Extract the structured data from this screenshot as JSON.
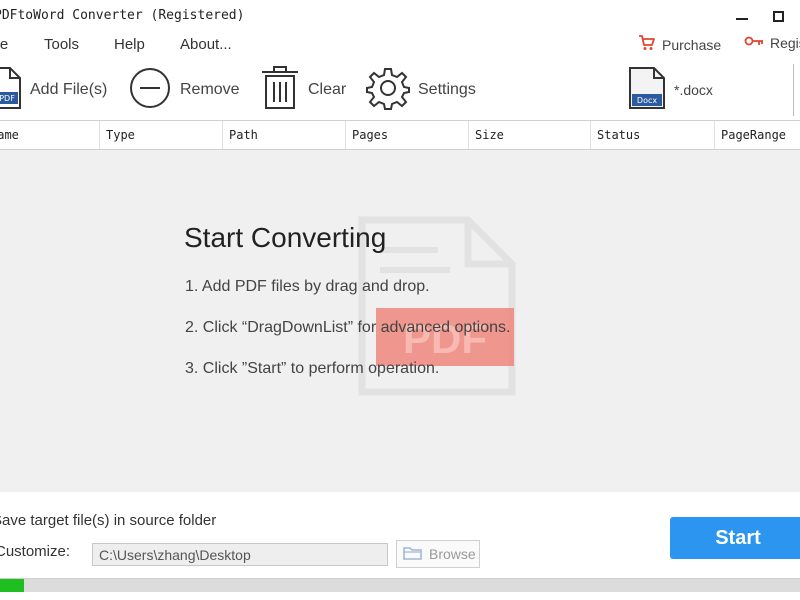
{
  "window": {
    "title": "PDFtoWord Converter (Registered)"
  },
  "menu": {
    "items": [
      {
        "label": "File"
      },
      {
        "label": "Tools"
      },
      {
        "label": "Help"
      },
      {
        "label": "About..."
      }
    ],
    "purchase_label": "Purchase",
    "register_label": "Register"
  },
  "toolbar": {
    "add_files_label": "Add File(s)",
    "remove_label": "Remove",
    "clear_label": "Clear",
    "settings_label": "Settings",
    "output_format_label": "*.docx",
    "docx_badge": "Docx",
    "pdf_badge": "PDF"
  },
  "table": {
    "columns": [
      "Name",
      "Type",
      "Path",
      "Pages",
      "Size",
      "Status",
      "PageRange"
    ]
  },
  "empty_state": {
    "title": "Start Converting",
    "steps": [
      "1. Add PDF files by drag and drop.",
      "2. Click “DragDownList” for advanced options.",
      "3. Click ”Start” to perform operation."
    ],
    "watermark_text": "PDF"
  },
  "output": {
    "save_in_source_label": "Save target file(s) in source folder",
    "customize_label": "Customize:",
    "path_value": "C:\\Users\\zhang\\Desktop",
    "browse_label": "Browse"
  },
  "actions": {
    "start_label": "Start"
  },
  "progress": {
    "value": 0.03
  },
  "colors": {
    "accent": "#2b95f0",
    "progress": "#1fbf1f",
    "purchase_icon": "#e0452f",
    "watermark_badge": "#ef7a6f"
  },
  "icons": {
    "add": "pdf-file-icon",
    "remove": "minus-circle-icon",
    "clear": "trash-icon",
    "settings": "gear-icon",
    "format": "docx-file-icon",
    "purchase": "cart-icon",
    "register": "key-icon",
    "browse": "folder-icon"
  }
}
